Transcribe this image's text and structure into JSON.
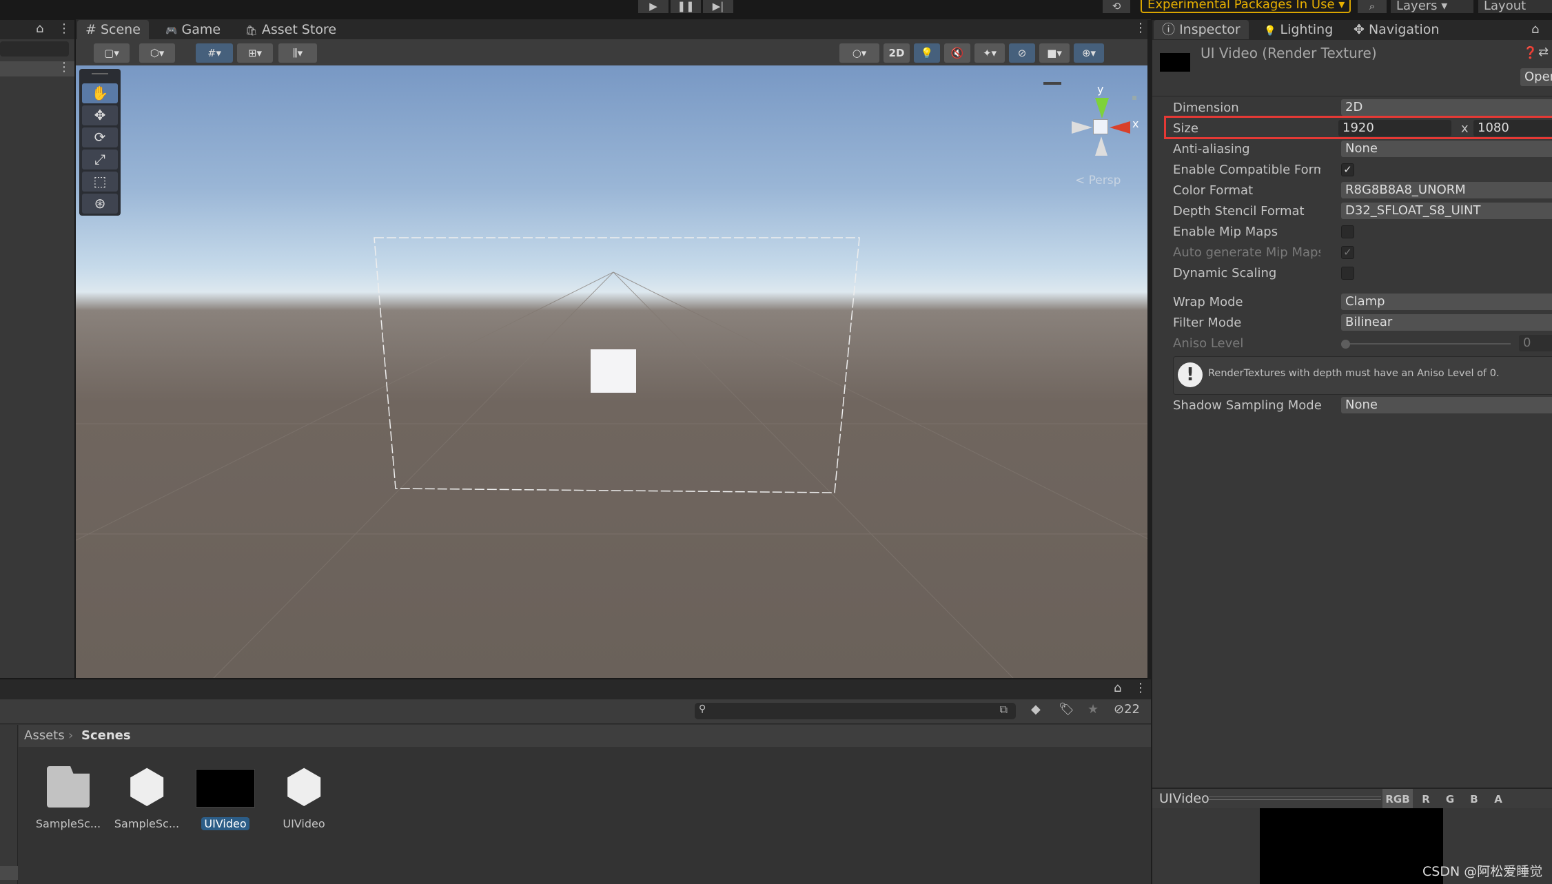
{
  "topbar": {
    "play": "▶",
    "pause": "❚❚",
    "step": "▶|",
    "history_icon": "history-icon",
    "experimental": "Experimental Packages In Use ▾",
    "search_icon": "search-icon",
    "layers": "Layers",
    "layout": "Layout"
  },
  "scene_tabs": [
    {
      "icon": "#",
      "label": "Scene"
    },
    {
      "icon": "🎮",
      "label": "Game"
    },
    {
      "icon": "🔒",
      "label": "Asset Store"
    }
  ],
  "scene_toolbar": {
    "two_d": "2D"
  },
  "gizmo": {
    "y": "y",
    "x": "x",
    "persp": "< Persp"
  },
  "inspector": {
    "tabs": [
      {
        "icon": "i",
        "label": "Inspector"
      },
      {
        "icon": "💡",
        "label": "Lighting"
      },
      {
        "icon": "✥",
        "label": "Navigation"
      }
    ],
    "title": "UI Video (Render Texture)",
    "open_button": "Open",
    "fields": {
      "dimension": {
        "label": "Dimension",
        "value": "2D"
      },
      "size": {
        "label": "Size",
        "width": "1920",
        "x": "x",
        "height": "1080"
      },
      "anti_aliasing": {
        "label": "Anti-aliasing",
        "value": "None"
      },
      "enable_compatible_format": {
        "label": "Enable Compatible Format",
        "checked": true
      },
      "color_format": {
        "label": "Color Format",
        "value": "R8G8B8A8_UNORM"
      },
      "depth_stencil_format": {
        "label": "Depth Stencil Format",
        "value": "D32_SFLOAT_S8_UINT"
      },
      "enable_mip_maps": {
        "label": "Enable Mip Maps",
        "checked": false
      },
      "auto_generate_mip_maps": {
        "label": "Auto generate Mip Maps",
        "checked": true
      },
      "dynamic_scaling": {
        "label": "Dynamic Scaling",
        "checked": false
      },
      "wrap_mode": {
        "label": "Wrap Mode",
        "value": "Clamp"
      },
      "filter_mode": {
        "label": "Filter Mode",
        "value": "Bilinear"
      },
      "aniso_level": {
        "label": "Aniso Level",
        "value": "0"
      },
      "shadow_sampling_mode": {
        "label": "Shadow Sampling Mode",
        "value": "None"
      }
    },
    "help_text": "RenderTextures with depth must have an Aniso Level of 0.",
    "preview": {
      "title": "UIVideo",
      "channels": [
        "RGB",
        "R",
        "G",
        "B",
        "A"
      ]
    }
  },
  "project": {
    "breadcrumb": [
      "Assets",
      "Scenes"
    ],
    "hidden_count": "22",
    "assets": [
      {
        "name": "SampleSc...",
        "type": "folder"
      },
      {
        "name": "SampleSc...",
        "type": "unity-scene"
      },
      {
        "name": "UIVideo",
        "type": "render-texture",
        "selected": true
      },
      {
        "name": "UIVideo",
        "type": "unity-scene"
      }
    ]
  },
  "watermark": "CSDN @阿松爱睡觉",
  "colors": {
    "accent": "#46607c",
    "highlight": "#e53935",
    "warning": "#e8b000",
    "selection": "#2c5d87"
  }
}
